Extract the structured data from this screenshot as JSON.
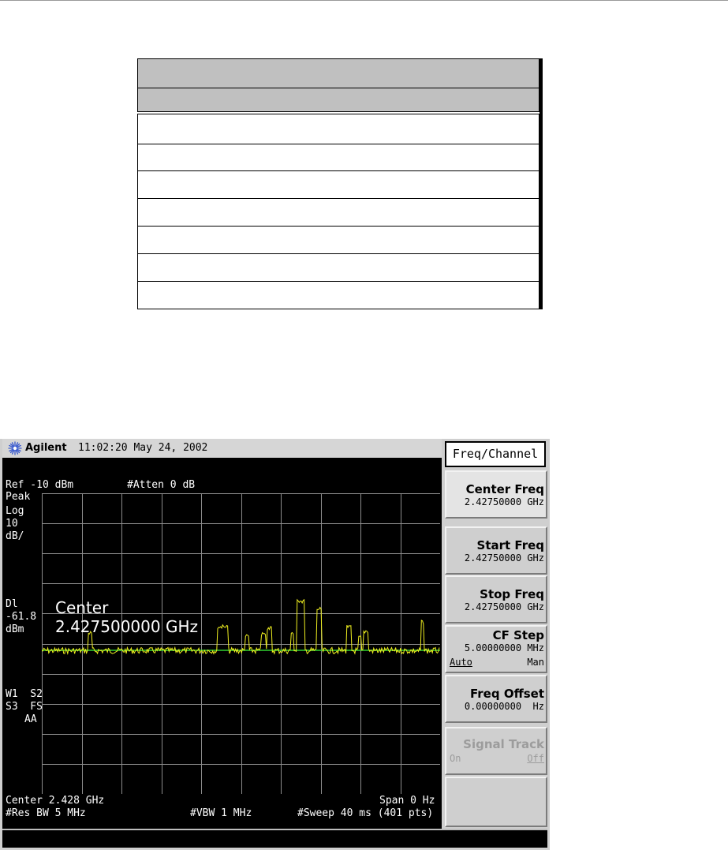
{
  "table": {
    "rows": 9
  },
  "analyzer": {
    "brand": "Agilent",
    "time": "11:02:20",
    "date": "May 24, 2002",
    "ref_level": "Ref -10 dBm",
    "attenuation": "#Atten 0 dB",
    "detector": "Peak",
    "scale_type": "Log",
    "scale_value": "10",
    "scale_unit": "dB/",
    "display_line_label": "Dl",
    "display_line_value": "-61.8",
    "display_line_unit": "dBm",
    "trace_state_1": "W1  S2",
    "trace_state_2": "S3  FS",
    "trace_state_3": "AA",
    "popup_title": "Center",
    "popup_value": "2.427500000 GHz",
    "center": "Center 2.428 GHz",
    "span": "Span 0 Hz",
    "rbw": "#Res BW 5 MHz",
    "vbw": "#VBW 1 MHz",
    "sweep": "#Sweep 40 ms (401 pts)",
    "trace_color": "#f0f020",
    "display_line_color": "#30d030",
    "grid_color": "#8c8c8c"
  },
  "softkeys": {
    "title": "Freq/Channel",
    "center_freq_label": "Center Freq",
    "center_freq_value": "2.42750000 GHz",
    "start_freq_label": "Start Freq",
    "start_freq_value": "2.42750000 GHz",
    "stop_freq_label": "Stop Freq",
    "stop_freq_value": "2.42750000 GHz",
    "cf_step_label": "CF Step",
    "cf_step_value": "5.00000000 MHz",
    "cf_step_auto": "Auto",
    "cf_step_man": "Man",
    "freq_offset_label": "Freq Offset",
    "freq_offset_value": "0.00000000  Hz",
    "signal_track_label": "Signal Track",
    "signal_track_on": "On",
    "signal_track_off": "Off"
  }
}
